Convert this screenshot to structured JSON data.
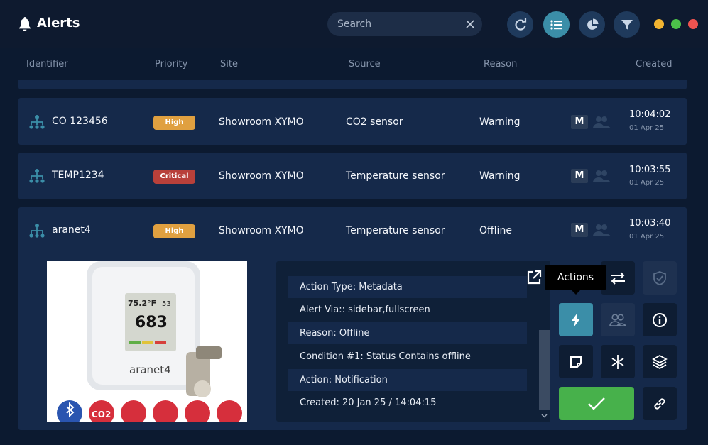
{
  "header": {
    "title": "Alerts",
    "search_placeholder": "Search"
  },
  "columns": [
    "Identifier",
    "Priority",
    "Site",
    "Source",
    "Reason",
    "Created"
  ],
  "rows": [
    {
      "identifier": "CO 123456",
      "priority": "High",
      "priority_color": "#e0a040",
      "site": "Showroom XYMO",
      "source": "CO2 sensor",
      "reason": "Warning",
      "badge": "M",
      "time": "10:04:02",
      "date": "01 Apr 25"
    },
    {
      "identifier": "TEMP1234",
      "priority": "Critical",
      "priority_color": "#b8403a",
      "site": "Showroom XYMO",
      "source": "Temperature sensor",
      "reason": "Warning",
      "badge": "M",
      "time": "10:03:55",
      "date": "01 Apr 25"
    },
    {
      "identifier": "aranet4",
      "priority": "High",
      "priority_color": "#e0a040",
      "site": "Showroom XYMO",
      "source": "Temperature sensor",
      "reason": "Offline",
      "badge": "M",
      "time": "10:03:40",
      "date": "01 Apr 25"
    }
  ],
  "device": {
    "temp": "75.2°F",
    "hum": "53",
    "co2": "683",
    "brand": "aranet4",
    "icons": [
      "bluetooth",
      "CO2",
      "°C °F",
      "%",
      "pressure",
      "cloud"
    ]
  },
  "details": [
    "Action Type: Metadata",
    "Alert Via:: sidebar,fullscreen",
    "Reason: Offline",
    "Condition #1: Status Contains offline",
    "Action: Notification",
    "Created: 20 Jan 25 / 14:04:15"
  ],
  "tooltip": "Actions",
  "colors": {
    "background": "#0c1a30",
    "row": "#15294a",
    "accent": "#3b8ea8",
    "confirm": "#47b14b"
  }
}
